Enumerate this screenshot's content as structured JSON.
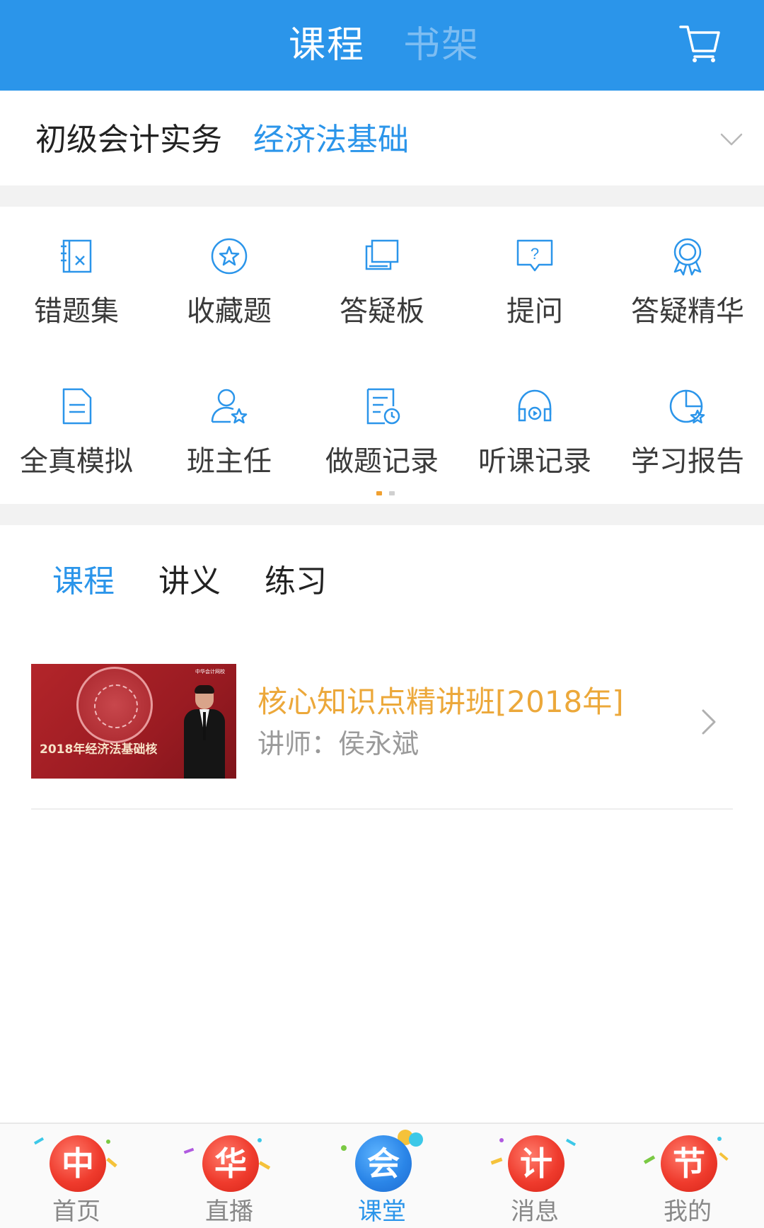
{
  "header": {
    "tabs": [
      {
        "label": "课程",
        "active": true
      },
      {
        "label": "书架",
        "active": false
      }
    ],
    "cart_icon": "shopping-cart-icon"
  },
  "subjects": {
    "items": [
      {
        "label": "初级会计实务",
        "active": false
      },
      {
        "label": "经济法基础",
        "active": true
      }
    ],
    "expand_icon": "chevron-down-icon"
  },
  "features": {
    "page_count": 2,
    "current_page": 1,
    "items": [
      {
        "label": "错题集",
        "icon": "wrong-questions-book-icon"
      },
      {
        "label": "收藏题",
        "icon": "star-favorite-icon"
      },
      {
        "label": "答疑板",
        "icon": "qa-board-icon"
      },
      {
        "label": "提问",
        "icon": "question-bubble-icon"
      },
      {
        "label": "答疑精华",
        "icon": "award-ribbon-icon"
      },
      {
        "label": "全真模拟",
        "icon": "exam-document-icon"
      },
      {
        "label": "班主任",
        "icon": "teacher-user-icon"
      },
      {
        "label": "做题记录",
        "icon": "practice-record-icon"
      },
      {
        "label": "听课记录",
        "icon": "headphones-icon"
      },
      {
        "label": "学习报告",
        "icon": "pie-chart-report-icon"
      }
    ]
  },
  "content_tabs": [
    {
      "label": "课程",
      "active": true
    },
    {
      "label": "讲义",
      "active": false
    },
    {
      "label": "练习",
      "active": false
    }
  ],
  "courses": [
    {
      "title": "核心知识点精讲班[2018年]",
      "teacher": "讲师：侯永斌",
      "thumbnail_text": "2018年经济法基础核",
      "thumbnail_logo": "中华会计网校"
    }
  ],
  "bottom_nav": [
    {
      "badge": "中",
      "label": "首页",
      "active": false
    },
    {
      "badge": "华",
      "label": "直播",
      "active": false
    },
    {
      "badge": "会",
      "label": "课堂",
      "active": true
    },
    {
      "badge": "计",
      "label": "消息",
      "active": false
    },
    {
      "badge": "节",
      "label": "我的",
      "active": false
    }
  ],
  "colors": {
    "brand_blue": "#2b95ea",
    "course_title_orange": "#eca83a",
    "badge_red": "#ef3b2d"
  }
}
